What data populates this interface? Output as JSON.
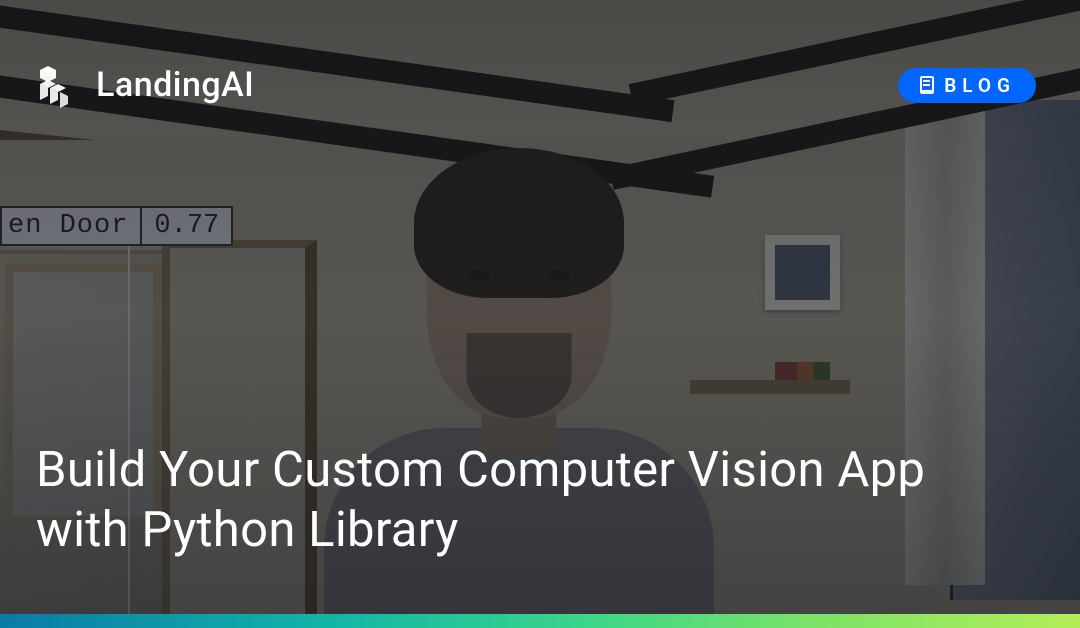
{
  "brand": {
    "name": "LandingAI"
  },
  "badge": {
    "label": "BLOG"
  },
  "hero": {
    "title": "Build Your Custom Computer Vision App with Python Library"
  },
  "detection": {
    "class_label": "en Door",
    "confidence": "0.77"
  },
  "colors": {
    "accent": "#0066ff",
    "gradient_start": "#0a7aa8",
    "gradient_end": "#b4ee58"
  }
}
